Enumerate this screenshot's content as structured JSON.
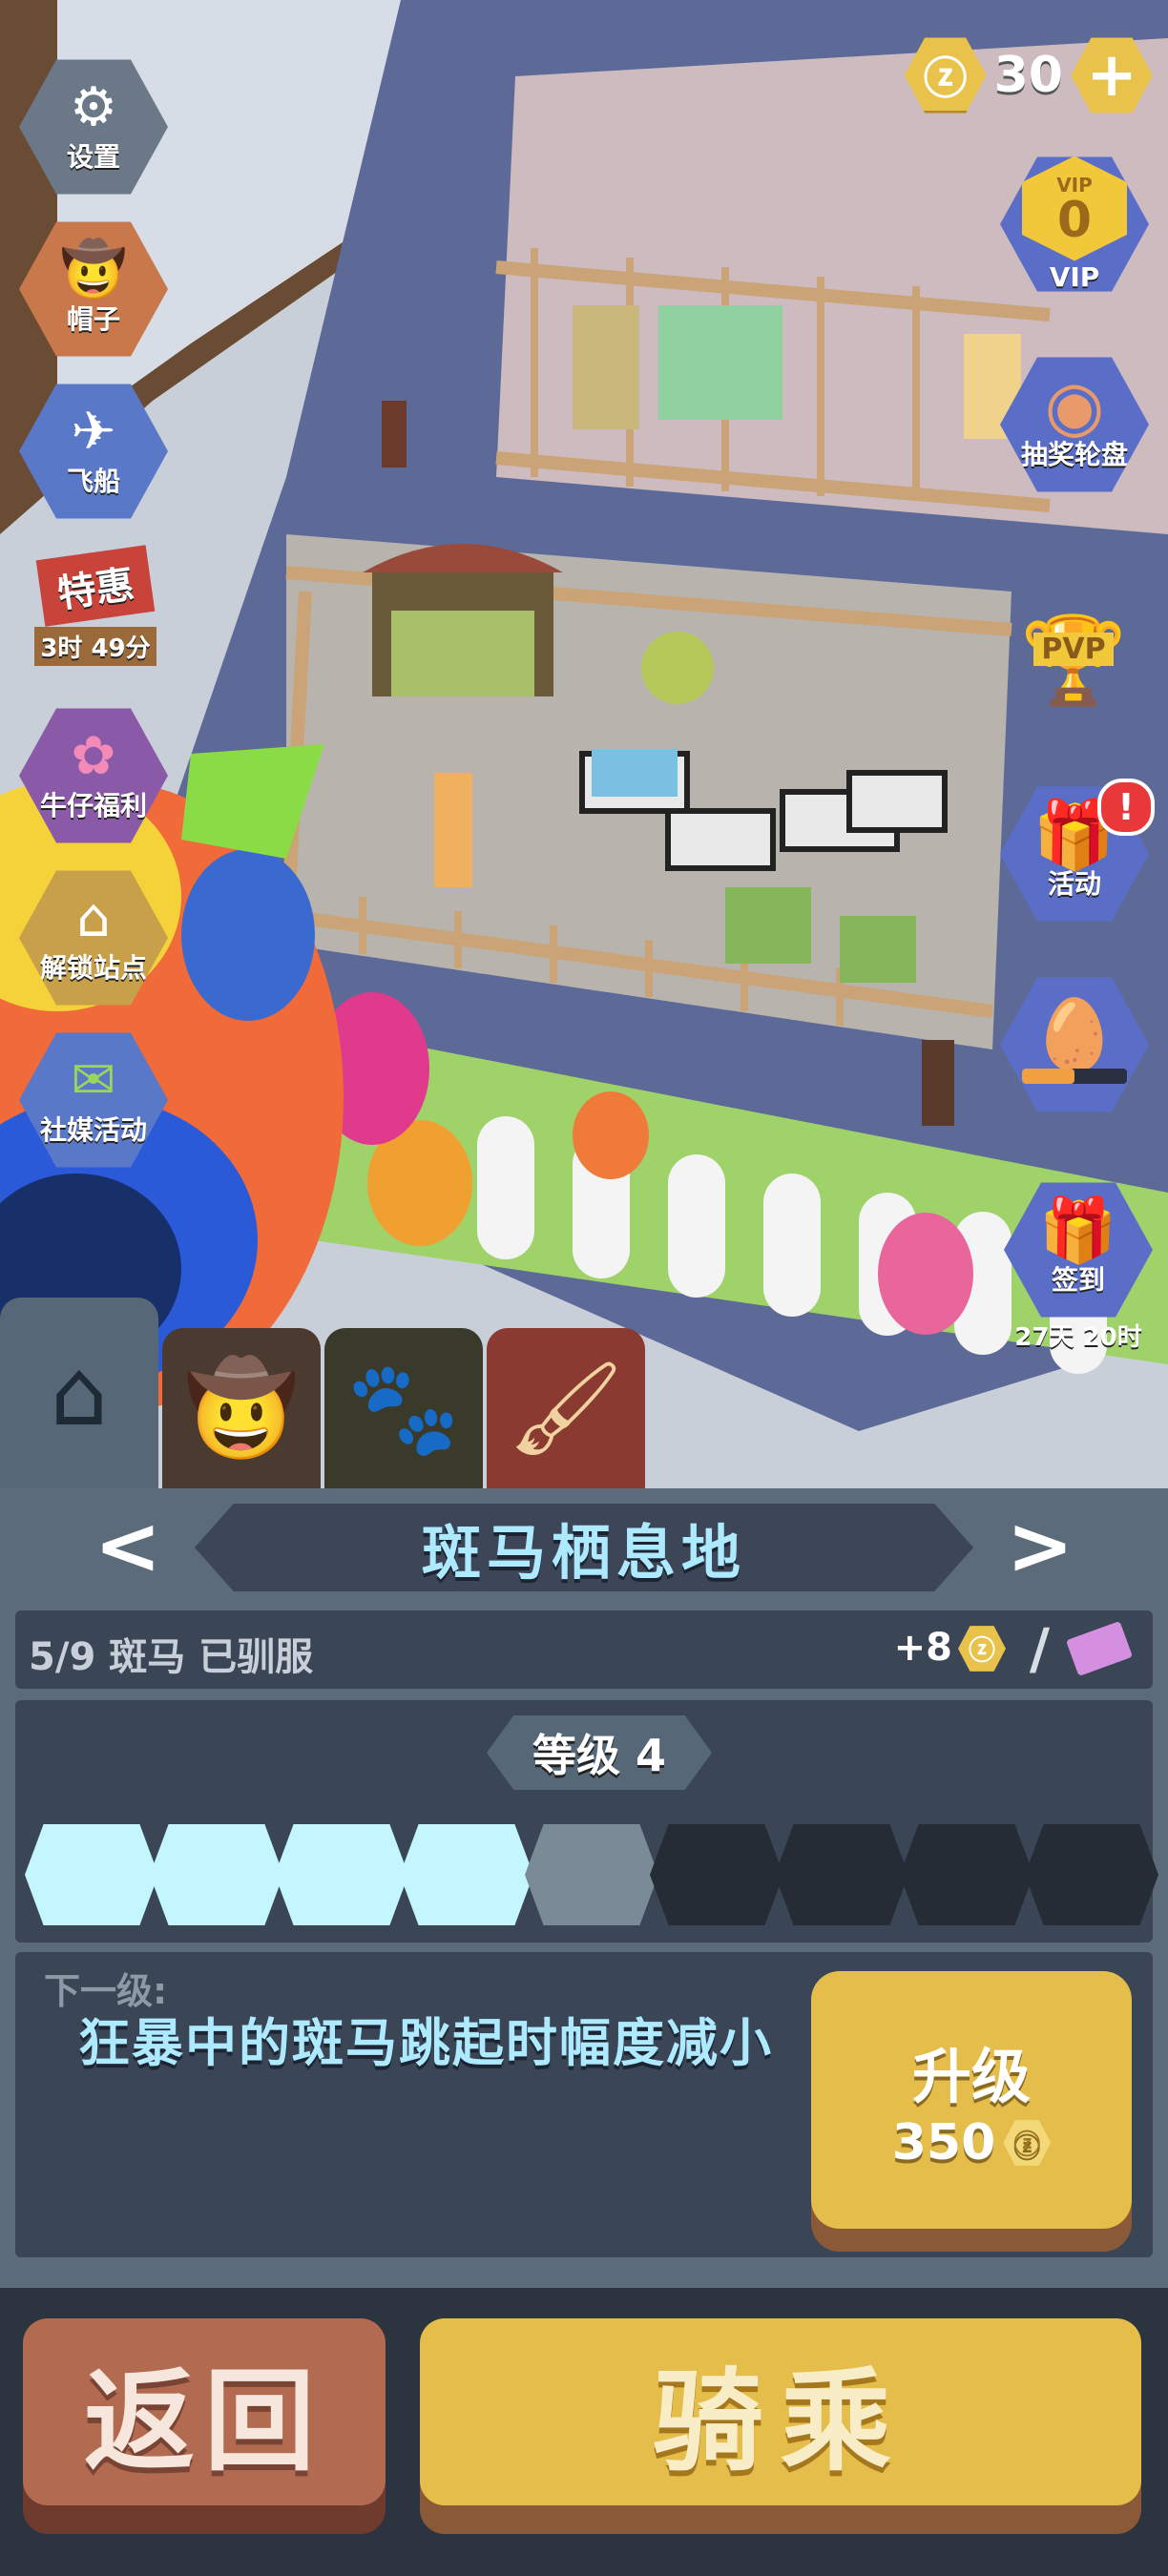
{
  "currency": {
    "icon": "ⓩ",
    "amount": "30",
    "add": "+"
  },
  "left_menu": [
    {
      "key": "settings",
      "label": "设置",
      "icon": "⚙"
    },
    {
      "key": "hat",
      "label": "帽子",
      "icon": "🤠"
    },
    {
      "key": "airship",
      "label": "飞船",
      "icon": "✈"
    },
    {
      "key": "special",
      "label": "特惠",
      "sub": "3时 49分",
      "icon": ""
    },
    {
      "key": "cowboy_welfare",
      "label": "牛仔福利",
      "icon": "✿"
    },
    {
      "key": "unlock_station",
      "label": "解锁站点",
      "icon": "⌂"
    },
    {
      "key": "social_event",
      "label": "社媒活动",
      "icon": "✉"
    }
  ],
  "right_menu": [
    {
      "key": "vip",
      "label": "VIP",
      "badge_text": "VIP",
      "value": "0"
    },
    {
      "key": "lottery",
      "label": "抽奖轮盘",
      "icon": "◉"
    },
    {
      "key": "pvp",
      "label": "PVP",
      "icon": "🏆"
    },
    {
      "key": "activity",
      "label": "活动",
      "icon": "🎁",
      "alert": "!"
    },
    {
      "key": "egg_progress",
      "label": "",
      "icon": "🥚",
      "progress": 0.5
    },
    {
      "key": "checkin",
      "label": "签到",
      "sub": "27天 20时",
      "icon": "🎁"
    }
  ],
  "tabs": [
    {
      "key": "home",
      "icon": "⌂",
      "active": true
    },
    {
      "key": "cowboy",
      "icon": "🤠",
      "active": false
    },
    {
      "key": "paw",
      "icon": "🐾",
      "active": false
    },
    {
      "key": "paint",
      "icon": "🖌",
      "active": false
    }
  ],
  "habitat": {
    "prev": "<",
    "next": ">",
    "title": "斑马栖息地",
    "tamed_text": "5/9 斑马 已驯服",
    "bonus": "+8",
    "coin_icon": "ⓩ",
    "slash": "/"
  },
  "level": {
    "label": "等级 4",
    "segments_total": 9,
    "segments_filled": 4,
    "segments_partial": 1
  },
  "next_level": {
    "label": "下一级:",
    "description": "狂暴中的斑马跳起时幅度减小"
  },
  "upgrade": {
    "label": "升级",
    "cost": "350",
    "coin_icon": "ⓩ"
  },
  "buttons": {
    "back": "返回",
    "ride": "骑乘"
  },
  "colors": {
    "accent_gold": "#e4bd4b",
    "back_red": "#b26a50",
    "progress_filled": "#c4f6ff",
    "progress_partial": "#7a8a96",
    "progress_empty": "#252c36",
    "title_text": "#aeeaff"
  }
}
